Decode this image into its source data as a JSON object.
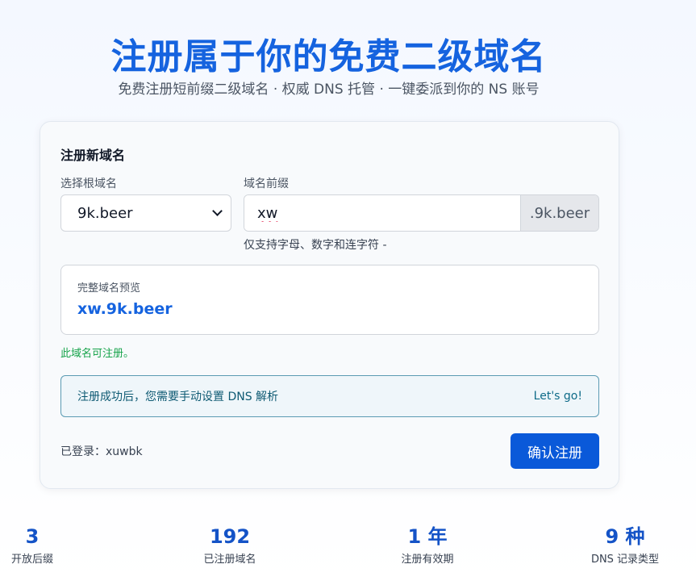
{
  "hero": {
    "title": "注册属于你的免费二级域名",
    "subtitle": "免费注册短前缀二级域名 · 权威 DNS 托管 · 一键委派到你的 NS 账号"
  },
  "form": {
    "title": "注册新域名",
    "root_label": "选择根域名",
    "root_selected": "9k.beer",
    "prefix_label": "域名前缀",
    "prefix_value": "xw",
    "suffix": ".9k.beer",
    "hint": "仅支持字母、数字和连字符 -",
    "preview_label": "完整域名预览",
    "preview_value": "xw.9k.beer",
    "availability": "此域名可注册。",
    "info_text": "注册成功后，您需要手动设置 DNS 解析",
    "info_link": "Let's go!",
    "logged_in": "已登录：xuwbk",
    "submit_label": "确认注册"
  },
  "stats": [
    {
      "value": "3",
      "label": "开放后缀"
    },
    {
      "value": "192",
      "label": "已注册域名"
    },
    {
      "value": "1 年",
      "label": "注册有效期"
    },
    {
      "value": "9 种",
      "label": "DNS 记录类型"
    }
  ],
  "colors": {
    "accent": "#1563df",
    "button": "#0a59d9",
    "success": "#16a34a",
    "info_border": "#5b9bb3"
  },
  "icons": {
    "select_arrow": "chevron-down-icon"
  }
}
